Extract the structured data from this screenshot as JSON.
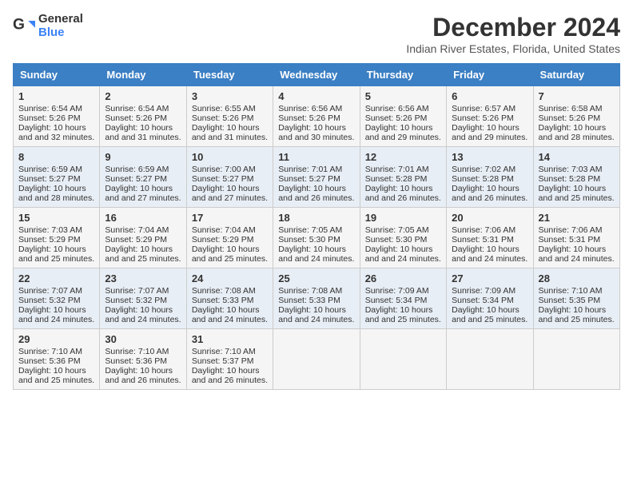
{
  "header": {
    "logo_general": "General",
    "logo_blue": "Blue",
    "month_title": "December 2024",
    "location": "Indian River Estates, Florida, United States"
  },
  "calendar": {
    "days_of_week": [
      "Sunday",
      "Monday",
      "Tuesday",
      "Wednesday",
      "Thursday",
      "Friday",
      "Saturday"
    ],
    "weeks": [
      [
        {
          "day": "1",
          "data": "Sunrise: 6:54 AM\nSunset: 5:26 PM\nDaylight: 10 hours and 32 minutes."
        },
        {
          "day": "2",
          "data": "Sunrise: 6:54 AM\nSunset: 5:26 PM\nDaylight: 10 hours and 31 minutes."
        },
        {
          "day": "3",
          "data": "Sunrise: 6:55 AM\nSunset: 5:26 PM\nDaylight: 10 hours and 31 minutes."
        },
        {
          "day": "4",
          "data": "Sunrise: 6:56 AM\nSunset: 5:26 PM\nDaylight: 10 hours and 30 minutes."
        },
        {
          "day": "5",
          "data": "Sunrise: 6:56 AM\nSunset: 5:26 PM\nDaylight: 10 hours and 29 minutes."
        },
        {
          "day": "6",
          "data": "Sunrise: 6:57 AM\nSunset: 5:26 PM\nDaylight: 10 hours and 29 minutes."
        },
        {
          "day": "7",
          "data": "Sunrise: 6:58 AM\nSunset: 5:26 PM\nDaylight: 10 hours and 28 minutes."
        }
      ],
      [
        {
          "day": "8",
          "data": "Sunrise: 6:59 AM\nSunset: 5:27 PM\nDaylight: 10 hours and 28 minutes."
        },
        {
          "day": "9",
          "data": "Sunrise: 6:59 AM\nSunset: 5:27 PM\nDaylight: 10 hours and 27 minutes."
        },
        {
          "day": "10",
          "data": "Sunrise: 7:00 AM\nSunset: 5:27 PM\nDaylight: 10 hours and 27 minutes."
        },
        {
          "day": "11",
          "data": "Sunrise: 7:01 AM\nSunset: 5:27 PM\nDaylight: 10 hours and 26 minutes."
        },
        {
          "day": "12",
          "data": "Sunrise: 7:01 AM\nSunset: 5:28 PM\nDaylight: 10 hours and 26 minutes."
        },
        {
          "day": "13",
          "data": "Sunrise: 7:02 AM\nSunset: 5:28 PM\nDaylight: 10 hours and 26 minutes."
        },
        {
          "day": "14",
          "data": "Sunrise: 7:03 AM\nSunset: 5:28 PM\nDaylight: 10 hours and 25 minutes."
        }
      ],
      [
        {
          "day": "15",
          "data": "Sunrise: 7:03 AM\nSunset: 5:29 PM\nDaylight: 10 hours and 25 minutes."
        },
        {
          "day": "16",
          "data": "Sunrise: 7:04 AM\nSunset: 5:29 PM\nDaylight: 10 hours and 25 minutes."
        },
        {
          "day": "17",
          "data": "Sunrise: 7:04 AM\nSunset: 5:29 PM\nDaylight: 10 hours and 25 minutes."
        },
        {
          "day": "18",
          "data": "Sunrise: 7:05 AM\nSunset: 5:30 PM\nDaylight: 10 hours and 24 minutes."
        },
        {
          "day": "19",
          "data": "Sunrise: 7:05 AM\nSunset: 5:30 PM\nDaylight: 10 hours and 24 minutes."
        },
        {
          "day": "20",
          "data": "Sunrise: 7:06 AM\nSunset: 5:31 PM\nDaylight: 10 hours and 24 minutes."
        },
        {
          "day": "21",
          "data": "Sunrise: 7:06 AM\nSunset: 5:31 PM\nDaylight: 10 hours and 24 minutes."
        }
      ],
      [
        {
          "day": "22",
          "data": "Sunrise: 7:07 AM\nSunset: 5:32 PM\nDaylight: 10 hours and 24 minutes."
        },
        {
          "day": "23",
          "data": "Sunrise: 7:07 AM\nSunset: 5:32 PM\nDaylight: 10 hours and 24 minutes."
        },
        {
          "day": "24",
          "data": "Sunrise: 7:08 AM\nSunset: 5:33 PM\nDaylight: 10 hours and 24 minutes."
        },
        {
          "day": "25",
          "data": "Sunrise: 7:08 AM\nSunset: 5:33 PM\nDaylight: 10 hours and 24 minutes."
        },
        {
          "day": "26",
          "data": "Sunrise: 7:09 AM\nSunset: 5:34 PM\nDaylight: 10 hours and 25 minutes."
        },
        {
          "day": "27",
          "data": "Sunrise: 7:09 AM\nSunset: 5:34 PM\nDaylight: 10 hours and 25 minutes."
        },
        {
          "day": "28",
          "data": "Sunrise: 7:10 AM\nSunset: 5:35 PM\nDaylight: 10 hours and 25 minutes."
        }
      ],
      [
        {
          "day": "29",
          "data": "Sunrise: 7:10 AM\nSunset: 5:36 PM\nDaylight: 10 hours and 25 minutes."
        },
        {
          "day": "30",
          "data": "Sunrise: 7:10 AM\nSunset: 5:36 PM\nDaylight: 10 hours and 26 minutes."
        },
        {
          "day": "31",
          "data": "Sunrise: 7:10 AM\nSunset: 5:37 PM\nDaylight: 10 hours and 26 minutes."
        },
        null,
        null,
        null,
        null
      ]
    ]
  }
}
